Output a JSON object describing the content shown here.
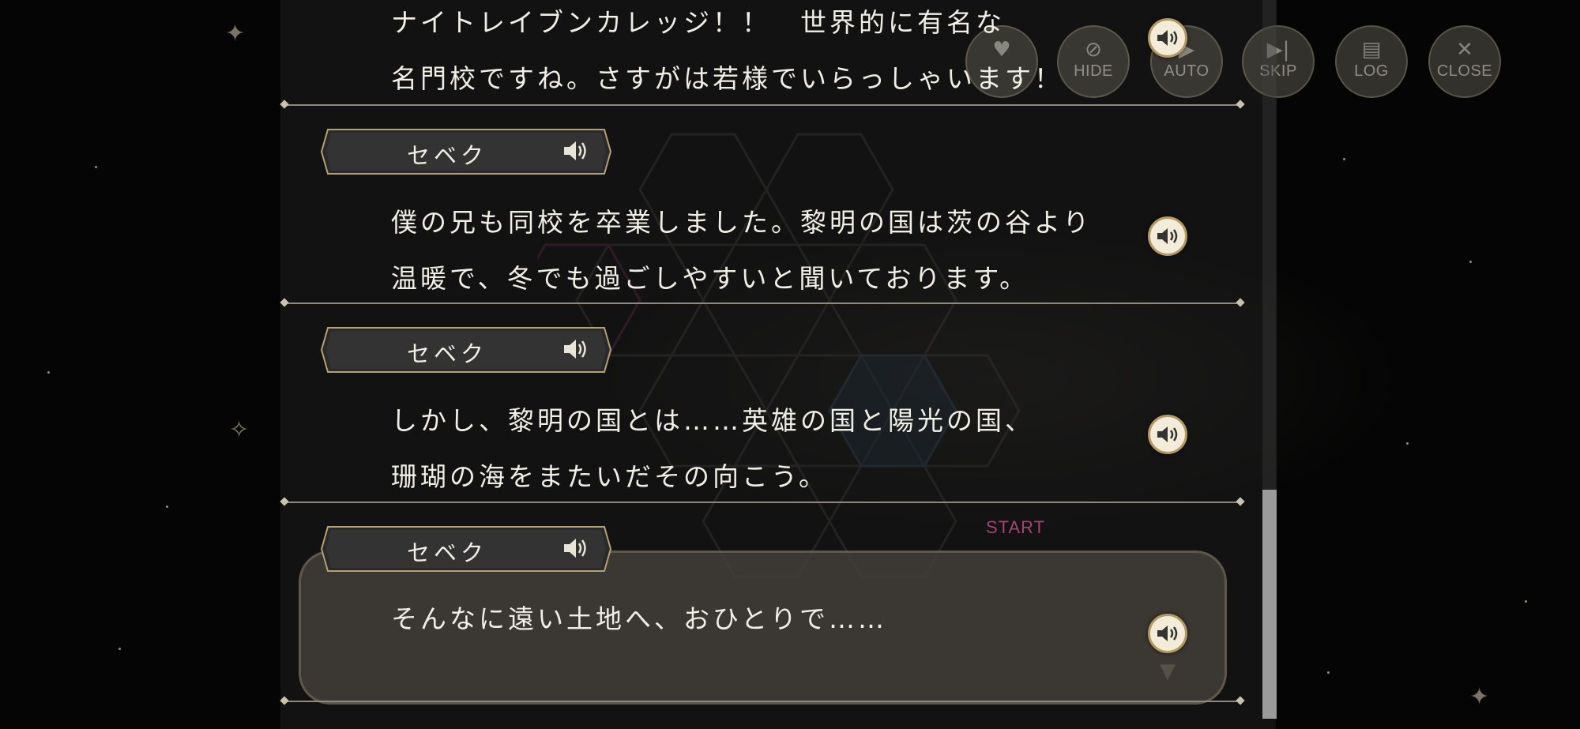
{
  "controls": [
    {
      "label": "",
      "icon": "heart-icon"
    },
    {
      "label": "HIDE",
      "icon": "eye-slash-icon"
    },
    {
      "label": "AUTO",
      "icon": "auto-icon"
    },
    {
      "label": "SKIP",
      "icon": "skip-icon"
    },
    {
      "label": "LOG",
      "icon": "log-icon"
    },
    {
      "label": "CLOSE",
      "icon": "close-icon"
    }
  ],
  "board": {
    "start_label": "START"
  },
  "entries": [
    {
      "speaker": "",
      "lines": [
        "ナイトレイブンカレッジ！！　世界的に有名な",
        "名門校ですね。さすがは若様でいらっしゃいます！"
      ]
    },
    {
      "speaker": "セベク",
      "lines": [
        "僕の兄も同校を卒業しました。黎明の国は茨の谷より",
        "温暖で、冬でも過ごしやすいと聞いております。"
      ]
    },
    {
      "speaker": "セベク",
      "lines": [
        "しかし、黎明の国とは……英雄の国と陽光の国、",
        "珊瑚の海をまたいだその向こう。"
      ]
    },
    {
      "speaker": "セベク",
      "lines": [
        "そんなに遠い土地へ、おひとりで……"
      ]
    }
  ],
  "colors": {
    "text": "#f1eee6",
    "voice_button": "#f3ecd8",
    "voice_border": "#b49a62"
  }
}
